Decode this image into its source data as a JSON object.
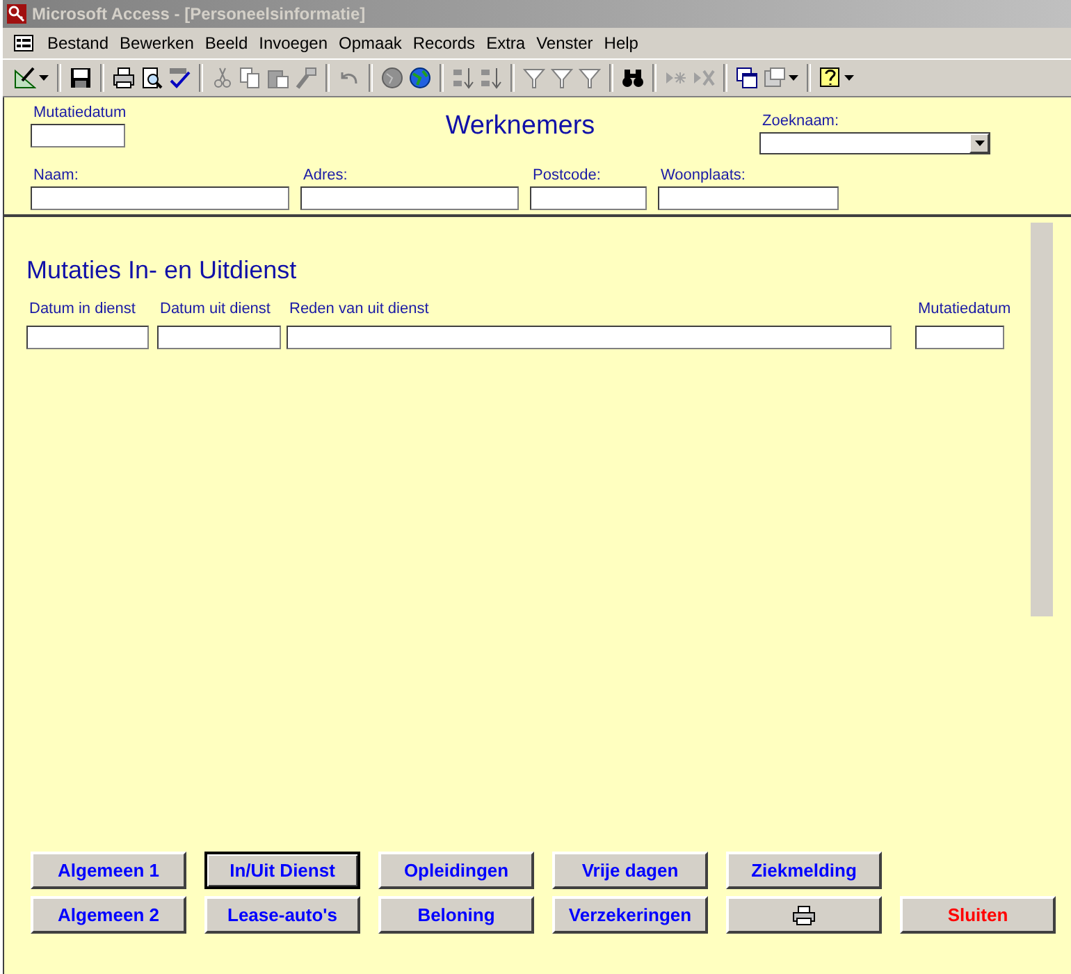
{
  "window": {
    "title": "Microsoft Access - [Personeelsinformatie]"
  },
  "menu": [
    "Bestand",
    "Bewerken",
    "Beeld",
    "Invoegen",
    "Opmaak",
    "Records",
    "Extra",
    "Venster",
    "Help"
  ],
  "header": {
    "date_label": "Mutatiedatum",
    "title": "Werknemers",
    "search_label": "Zoeknaam:",
    "fields": [
      {
        "label": "Naam:"
      },
      {
        "label": "Adres:"
      },
      {
        "label": "Postcode:"
      },
      {
        "label": "Woonplaats:"
      }
    ]
  },
  "detail": {
    "heading": "Mutaties In- en Uitdienst",
    "columns": [
      {
        "label": "Datum in dienst"
      },
      {
        "label": "Datum uit dienst"
      },
      {
        "label": "Reden van uit dienst"
      },
      {
        "label": "Mutatiedatum"
      }
    ]
  },
  "buttons": [
    [
      {
        "kind": "nav",
        "label": "Algemeen 1",
        "selected": false
      },
      {
        "kind": "nav",
        "label": "In/Uit Dienst",
        "selected": true
      },
      {
        "kind": "nav",
        "label": "Opleidingen",
        "selected": false
      },
      {
        "kind": "nav",
        "label": "Vrije dagen",
        "selected": false
      },
      {
        "kind": "nav",
        "label": "Ziekmelding",
        "selected": false
      }
    ],
    [
      {
        "kind": "nav",
        "label": "Algemeen 2",
        "selected": false
      },
      {
        "kind": "nav",
        "label": "Lease-auto's",
        "selected": false
      },
      {
        "kind": "nav",
        "label": "Beloning",
        "selected": false
      },
      {
        "kind": "nav",
        "label": "Verzekeringen",
        "selected": false
      },
      {
        "kind": "print",
        "selected": false
      },
      {
        "kind": "close",
        "label": "Sluiten",
        "selected": false
      }
    ]
  ]
}
